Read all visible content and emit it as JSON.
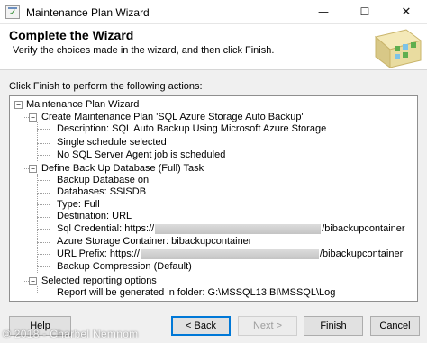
{
  "window": {
    "title": "Maintenance Plan Wizard",
    "controls": {
      "minimize": "—",
      "maximize": "☐",
      "close": "✕"
    }
  },
  "header": {
    "title": "Complete the Wizard",
    "subtitle": "Verify the choices made in the wizard, and then click Finish."
  },
  "instructions": "Click Finish to perform the following actions:",
  "tree": {
    "root": "Maintenance Plan Wizard",
    "sections": [
      {
        "label": "Create Maintenance Plan 'SQL Azure Storage Auto Backup'",
        "items": [
          "Description: SQL Auto Backup Using Microsoft Azure Storage",
          "Single schedule selected",
          "No SQL Server Agent job is scheduled"
        ]
      },
      {
        "label": "Define Back Up Database (Full) Task",
        "items": [
          "Backup Database on",
          "Databases: SSISDB",
          "Type: Full",
          "Destination: URL"
        ],
        "credential": {
          "prefix": "Sql Credential: https://",
          "suffix": "/bibackupcontainer"
        },
        "container": "Azure Storage Container: bibackupcontainer",
        "url_prefix": {
          "prefix": "URL Prefix: https://",
          "suffix": "/bibackupcontainer"
        },
        "compression": "Backup Compression (Default)"
      },
      {
        "label": "Selected reporting options",
        "items": [
          "Report will be generated in folder: G:\\MSSQL13.BI\\MSSQL\\Log"
        ]
      }
    ]
  },
  "buttons": {
    "help": "Help",
    "back": "< Back",
    "next": "Next >",
    "finish": "Finish",
    "cancel": "Cancel"
  },
  "watermark": "© 2018 - Charbel Nemnom"
}
